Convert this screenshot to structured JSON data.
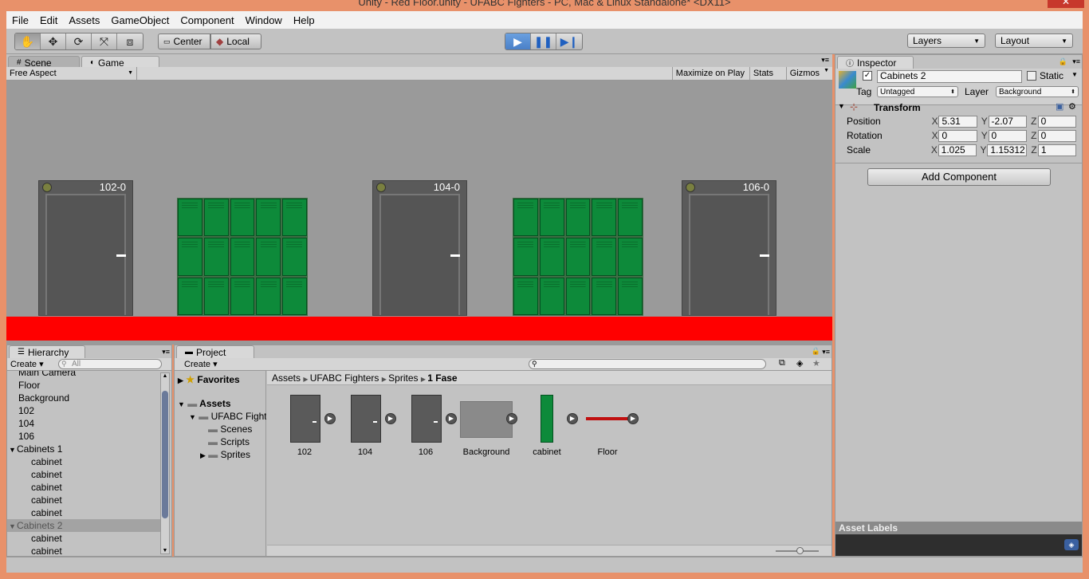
{
  "window": {
    "title": "Unity - Red Floor.unity - UFABC Fighters - PC, Mac & Linux Standalone* <DX11>",
    "close_symbol": "✕"
  },
  "menu": [
    "File",
    "Edit",
    "Assets",
    "GameObject",
    "Component",
    "Window",
    "Help"
  ],
  "toolbar": {
    "pivot_label": "Center",
    "space_label": "Local",
    "layers_label": "Layers",
    "layout_label": "Layout",
    "tools": [
      "hand-tool",
      "move-tool",
      "rotate-tool",
      "scale-tool",
      "rect-tool"
    ],
    "play_state": "playing"
  },
  "scene_tabs": [
    {
      "label": "Scene",
      "active": false
    },
    {
      "label": "Game",
      "active": true
    }
  ],
  "game_toolbar": {
    "aspect": "Free Aspect",
    "maximize": "Maximize on Play",
    "stats": "Stats",
    "gizmos": "Gizmos"
  },
  "game_view": {
    "background_color": "#9a9a9a",
    "floor_color": "#ff0000",
    "doors": [
      "102-0",
      "104-0",
      "106-0"
    ]
  },
  "hierarchy": {
    "tab": "Hierarchy",
    "create": "Create",
    "search_placeholder": "All",
    "items": [
      {
        "label": "Main Camera",
        "level": 0
      },
      {
        "label": "Floor",
        "level": 0
      },
      {
        "label": "Background",
        "level": 0
      },
      {
        "label": "102",
        "level": 0
      },
      {
        "label": "104",
        "level": 0
      },
      {
        "label": "106",
        "level": 0
      },
      {
        "label": "Cabinets 1",
        "level": 0,
        "expanded": true
      },
      {
        "label": "cabinet",
        "level": 1
      },
      {
        "label": "cabinet",
        "level": 1
      },
      {
        "label": "cabinet",
        "level": 1
      },
      {
        "label": "cabinet",
        "level": 1
      },
      {
        "label": "cabinet",
        "level": 1
      },
      {
        "label": "Cabinets 2",
        "level": 0,
        "expanded": true,
        "selected": true
      },
      {
        "label": "cabinet",
        "level": 1
      },
      {
        "label": "cabinet",
        "level": 1
      }
    ]
  },
  "project": {
    "tab": "Project",
    "create": "Create",
    "tree": {
      "favorites": "Favorites",
      "assets": "Assets",
      "project_folder": "UFABC Fight",
      "subfolders": [
        "Scenes",
        "Scripts",
        "Sprites"
      ]
    },
    "breadcrumb": [
      "Assets",
      "UFABC Fighters",
      "Sprites",
      "1 Fase"
    ],
    "assets": [
      "102",
      "104",
      "106",
      "Background",
      "cabinet",
      "Floor"
    ]
  },
  "inspector": {
    "tab": "Inspector",
    "object_name": "Cabinets 2",
    "static_label": "Static",
    "tag_label": "Tag",
    "tag_value": "Untagged",
    "layer_label": "Layer",
    "layer_value": "Background",
    "transform": {
      "title": "Transform",
      "position": {
        "label": "Position",
        "x": "5.31",
        "y": "-2.07",
        "z": "0"
      },
      "rotation": {
        "label": "Rotation",
        "x": "0",
        "y": "0",
        "z": "0"
      },
      "scale": {
        "label": "Scale",
        "x": "1.025",
        "y": "1.15312",
        "z": "1"
      }
    },
    "add_component": "Add Component",
    "asset_labels": "Asset Labels"
  }
}
